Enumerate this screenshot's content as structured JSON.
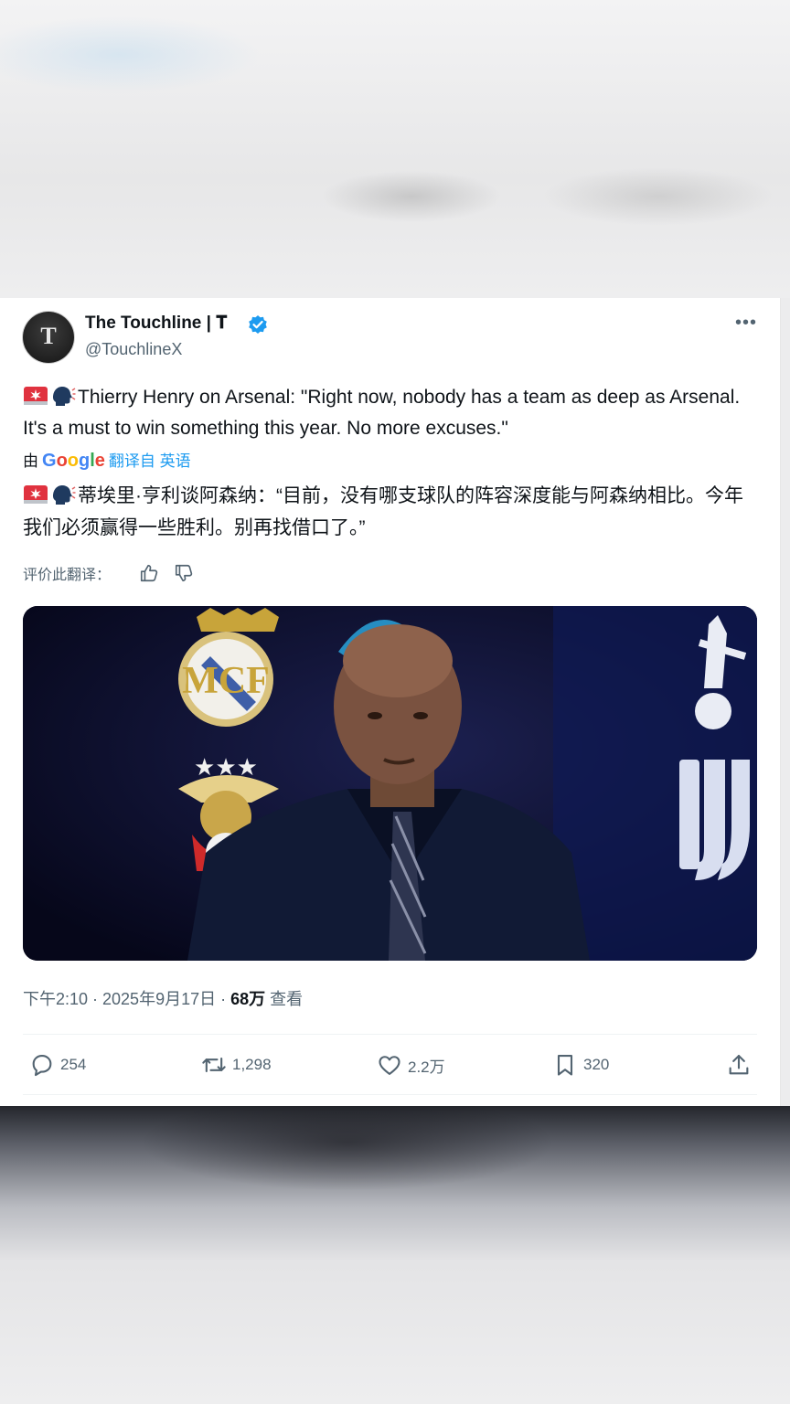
{
  "tweet": {
    "author_name": "The Touchline | 𝐓",
    "author_handle": "@TouchlineX",
    "avatar_letter": "T",
    "text_en": "Thierry Henry on Arsenal: \"Right now, nobody has a team as deep as Arsenal. It's a must to win something this year. No more excuses.\"",
    "translated_by_prefix": "由",
    "translate_link": "翻译自 英语",
    "text_zh": "蒂埃里·亨利谈阿森纳：“目前，没有哪支球队的阵容深度能与阿森纳相比。今年我们必须赢得一些胜利。别再找借口了。”",
    "rate_label": "评价此翻译：",
    "time": "下午2:10 · 2025年9月17日 · ",
    "views_count": "68万",
    "views_label": " 查看"
  },
  "actions": {
    "replies": "254",
    "retweets": "1,298",
    "likes": "2.2万",
    "bookmarks": "320"
  },
  "colors": {
    "accent": "#1d9bf0",
    "text": "#0f1419",
    "secondary": "#536471"
  },
  "icons": [
    "verified-badge-icon",
    "more-icon",
    "siren-icon",
    "speaking-head-icon",
    "thumbs-up-icon",
    "thumbs-down-icon",
    "reply-icon",
    "retweet-icon",
    "like-icon",
    "bookmark-icon",
    "share-icon"
  ]
}
